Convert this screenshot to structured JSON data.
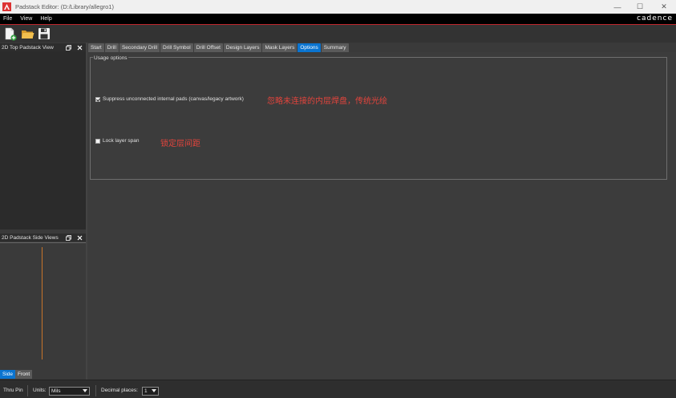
{
  "window": {
    "title": "Padstack Editor:  (D:/Library/allegro1)",
    "controls": {
      "minimize": "—",
      "maximize": "☐",
      "close": "✕"
    }
  },
  "menubar": {
    "items": [
      {
        "label": "File"
      },
      {
        "label": "View"
      },
      {
        "label": "Help"
      }
    ],
    "brand": "cadence"
  },
  "toolbar": {
    "buttons": [
      {
        "icon": "new-padstack-icon"
      },
      {
        "icon": "open-folder-icon"
      },
      {
        "icon": "save-disk-icon"
      }
    ]
  },
  "panels": {
    "top_view": {
      "title": "2D Top Padstack View"
    },
    "side_views": {
      "title": "2D Padstack Side Views"
    },
    "view_tabs": [
      {
        "label": "Side",
        "active": true
      },
      {
        "label": "Front",
        "active": false
      }
    ]
  },
  "tabs": [
    {
      "label": "Start",
      "active": false
    },
    {
      "label": "Drill",
      "active": false
    },
    {
      "label": "Secondary Drill",
      "active": false
    },
    {
      "label": "Drill Symbol",
      "active": false
    },
    {
      "label": "Drill Offset",
      "active": false
    },
    {
      "label": "Design Layers",
      "active": false
    },
    {
      "label": "Mask Layers",
      "active": false
    },
    {
      "label": "Options",
      "active": true
    },
    {
      "label": "Summary",
      "active": false
    }
  ],
  "usage_options": {
    "legend": "Usage options",
    "suppress": {
      "label": "Suppress unconnected internal pads (canvas/legacy artwork)",
      "checked": true,
      "annotation": "忽略未连接的内层焊盘，传统光绘"
    },
    "lock": {
      "label": "Lock layer span",
      "checked": false,
      "annotation": "锁定层间距"
    }
  },
  "statusbar": {
    "pad_type": "Thru Pin",
    "units_label": "Units:",
    "units_value": "Mils",
    "decimal_label": "Decimal places:",
    "decimal_value": "1"
  },
  "colors": {
    "accent_tab": "#0a74d0",
    "brand_line": "#c0262d",
    "annotation": "#e2443c",
    "side_view_line": "#c8742a"
  }
}
